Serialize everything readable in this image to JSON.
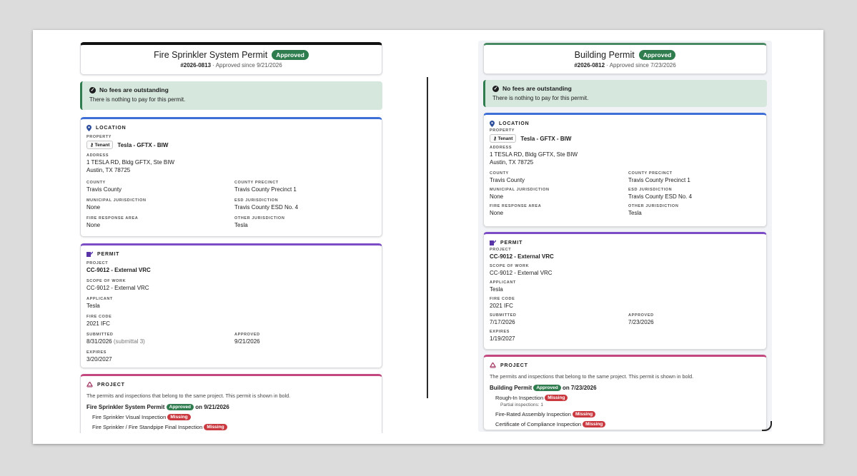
{
  "left": {
    "title": "Fire Sprinkler System Permit",
    "status": "Approved",
    "number": "#2026-0813",
    "subtitle": "· Approved since 9/21/2026",
    "alert_title": "No fees are outstanding",
    "alert_text": "There is nothing to pay for this permit.",
    "location": {
      "heading": "LOCATION",
      "property_label": "PROPERTY",
      "tenant_tag": "Tenant",
      "property_value": "Tesla - GFTX - BIW",
      "address_label": "ADDRESS",
      "address_line1": "1 TESLA RD, Bldg GFTX, Ste BIW",
      "address_line2": "Austin, TX 78725",
      "county_label": "COUNTY",
      "county_value": "Travis County",
      "precinct_label": "COUNTY PRECINCT",
      "precinct_value": "Travis County Precinct 1",
      "municipal_label": "MUNICIPAL JURISDICTION",
      "municipal_value": "None",
      "esd_label": "ESD JURISDICTION",
      "esd_value": "Travis County ESD No. 4",
      "fire_area_label": "FIRE RESPONSE AREA",
      "fire_area_value": "None",
      "other_label": "OTHER JURISDICTION",
      "other_value": "Tesla"
    },
    "permit": {
      "heading": "PERMIT",
      "project_label": "PROJECT",
      "project_value": "CC-9012 - External VRC",
      "scope_label": "SCOPE OF WORK",
      "scope_value": "CC-9012 - External VRC",
      "applicant_label": "APPLICANT",
      "applicant_value": "Tesla",
      "fire_code_label": "FIRE CODE",
      "fire_code_value": "2021 IFC",
      "submitted_label": "SUBMITTED",
      "submitted_value": "8/31/2026",
      "submitted_note": "(submittal 3)",
      "approved_label": "APPROVED",
      "approved_value": "9/21/2026",
      "expires_label": "EXPIRES",
      "expires_value": "3/20/2027"
    },
    "project": {
      "heading": "PROJECT",
      "description": "The permits and inspections that belong to the same project. This permit is shown in bold.",
      "permit_name": "Fire Sprinkler System Permit",
      "permit_status": "Approved",
      "permit_date": "on 9/21/2026",
      "inspections": [
        {
          "name": "Fire Sprinkler Visual Inspection",
          "status": "Missing"
        },
        {
          "name": "Fire Sprinkler / Fire Standpipe Final Inspection",
          "status": "Missing"
        }
      ]
    }
  },
  "right": {
    "title": "Building Permit",
    "status": "Approved",
    "number": "#2026-0812",
    "subtitle": "· Approved since 7/23/2026",
    "alert_title": "No fees are outstanding",
    "alert_text": "There is nothing to pay for this permit.",
    "location": {
      "heading": "LOCATION",
      "property_label": "PROPERTY",
      "tenant_tag": "Tenant",
      "property_value": "Tesla - GFTX - BIW",
      "address_label": "ADDRESS",
      "address_line1": "1 TESLA RD, Bldg GFTX, Ste BIW",
      "address_line2": "Austin, TX 78725",
      "county_label": "COUNTY",
      "county_value": "Travis County",
      "precinct_label": "COUNTY PRECINCT",
      "precinct_value": "Travis County Precinct 1",
      "municipal_label": "MUNICIPAL JURISDICTION",
      "municipal_value": "None",
      "esd_label": "ESD JURISDICTION",
      "esd_value": "Travis County ESD No. 4",
      "fire_area_label": "FIRE RESPONSE AREA",
      "fire_area_value": "None",
      "other_label": "OTHER JURISDICTION",
      "other_value": "Tesla"
    },
    "permit": {
      "heading": "PERMIT",
      "project_label": "PROJECT",
      "project_value": "CC-9012 - External VRC",
      "scope_label": "SCOPE OF WORK",
      "scope_value": "CC-9012 - External VRC",
      "applicant_label": "APPLICANT",
      "applicant_value": "Tesla",
      "fire_code_label": "FIRE CODE",
      "fire_code_value": "2021 IFC",
      "submitted_label": "SUBMITTED",
      "submitted_value": "7/17/2026",
      "approved_label": "APPROVED",
      "approved_value": "7/23/2026",
      "expires_label": "EXPIRES",
      "expires_value": "1/19/2027"
    },
    "project": {
      "heading": "PROJECT",
      "description": "The permits and inspections that belong to the same project. This permit is shown in bold.",
      "permit_name": "Building Permit",
      "permit_status": "Approved",
      "permit_date": "on 7/23/2026",
      "inspections": [
        {
          "name": "Rough-In Inspection",
          "status": "Missing",
          "sub": "Partial inspections: 1"
        },
        {
          "name": "Fire-Rated Assembly Inspection",
          "status": "Missing"
        },
        {
          "name": "Certificate of Compliance Inspection",
          "status": "Missing"
        }
      ]
    }
  },
  "colors": {
    "approved": "#2f7d4f",
    "missing": "#c9393f",
    "location_accent": "#3d6fd6",
    "permit_accent": "#7b4cc6",
    "project_accent": "#c2487f"
  },
  "icons": [
    "check-circle-icon",
    "map-pin-icon",
    "key-icon",
    "permit-icon",
    "project-icon"
  ]
}
